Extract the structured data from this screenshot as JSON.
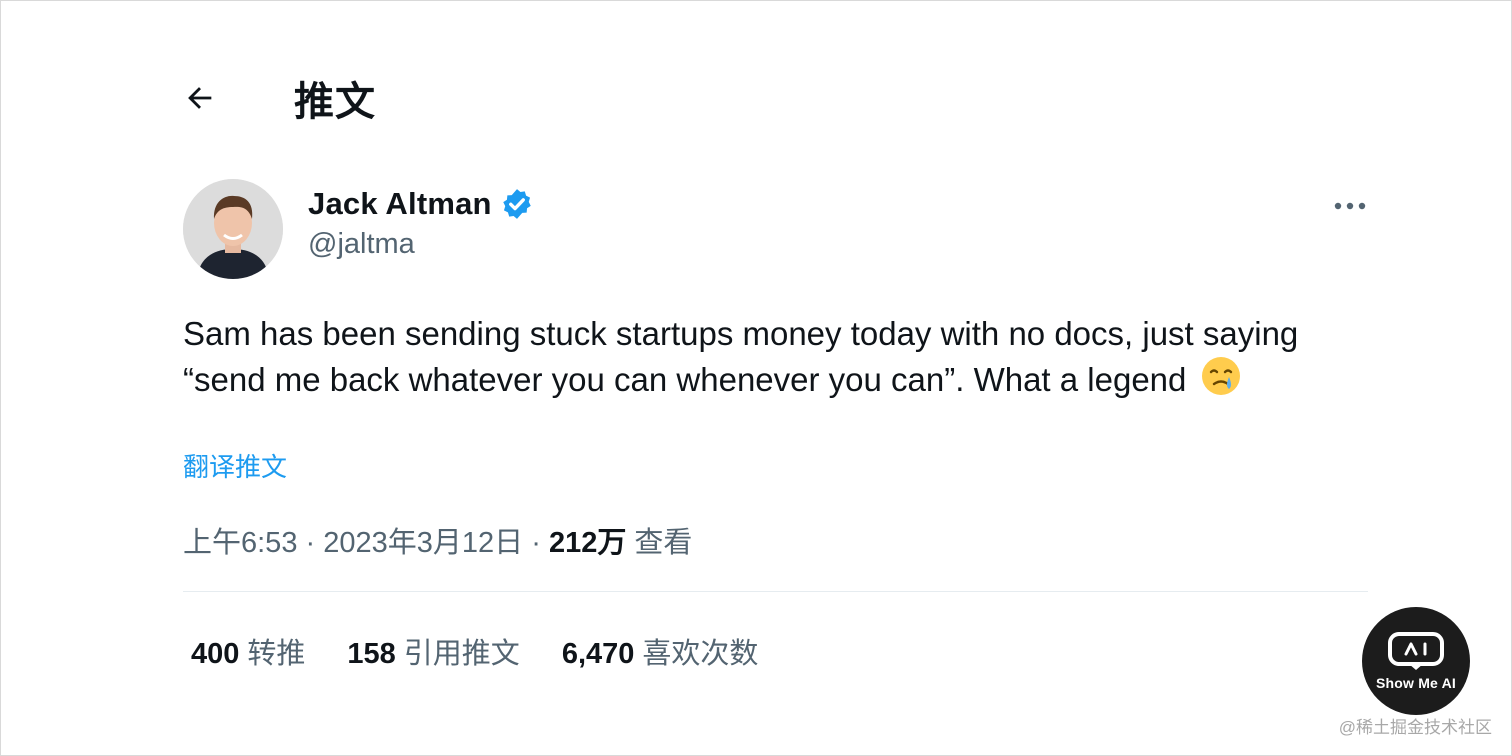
{
  "header": {
    "back_icon": "arrow-left-icon",
    "title": "推文"
  },
  "tweet": {
    "author": {
      "display_name": "Jack Altman",
      "handle": "@jaltma",
      "verified_icon": "verified-badge-icon",
      "verified_color": "#1d9bf0"
    },
    "more_icon": "more-horizontal-icon",
    "text": "Sam has been sending stuck startups money today with no docs, just saying “send me back whatever you can whenever you can”. What a legend",
    "emoji_icon": "face-holding-back-tears-emoji",
    "translate_label": "翻译推文",
    "time": "上午6:53",
    "separator": "·",
    "date": "2023年3月12日",
    "views_count": "212万",
    "views_label": "查看"
  },
  "stats": [
    {
      "count": "400",
      "label": "转推"
    },
    {
      "count": "158",
      "label": "引用推文"
    },
    {
      "count": "6,470",
      "label": "喜欢次数"
    }
  ],
  "badge": {
    "icon": "robot-face-icon",
    "text": "Show Me AI"
  },
  "watermark": "@稀土掘金技术社区",
  "colors": {
    "accent": "#1d9bf0",
    "text": "#0f1419",
    "muted": "#536471"
  }
}
